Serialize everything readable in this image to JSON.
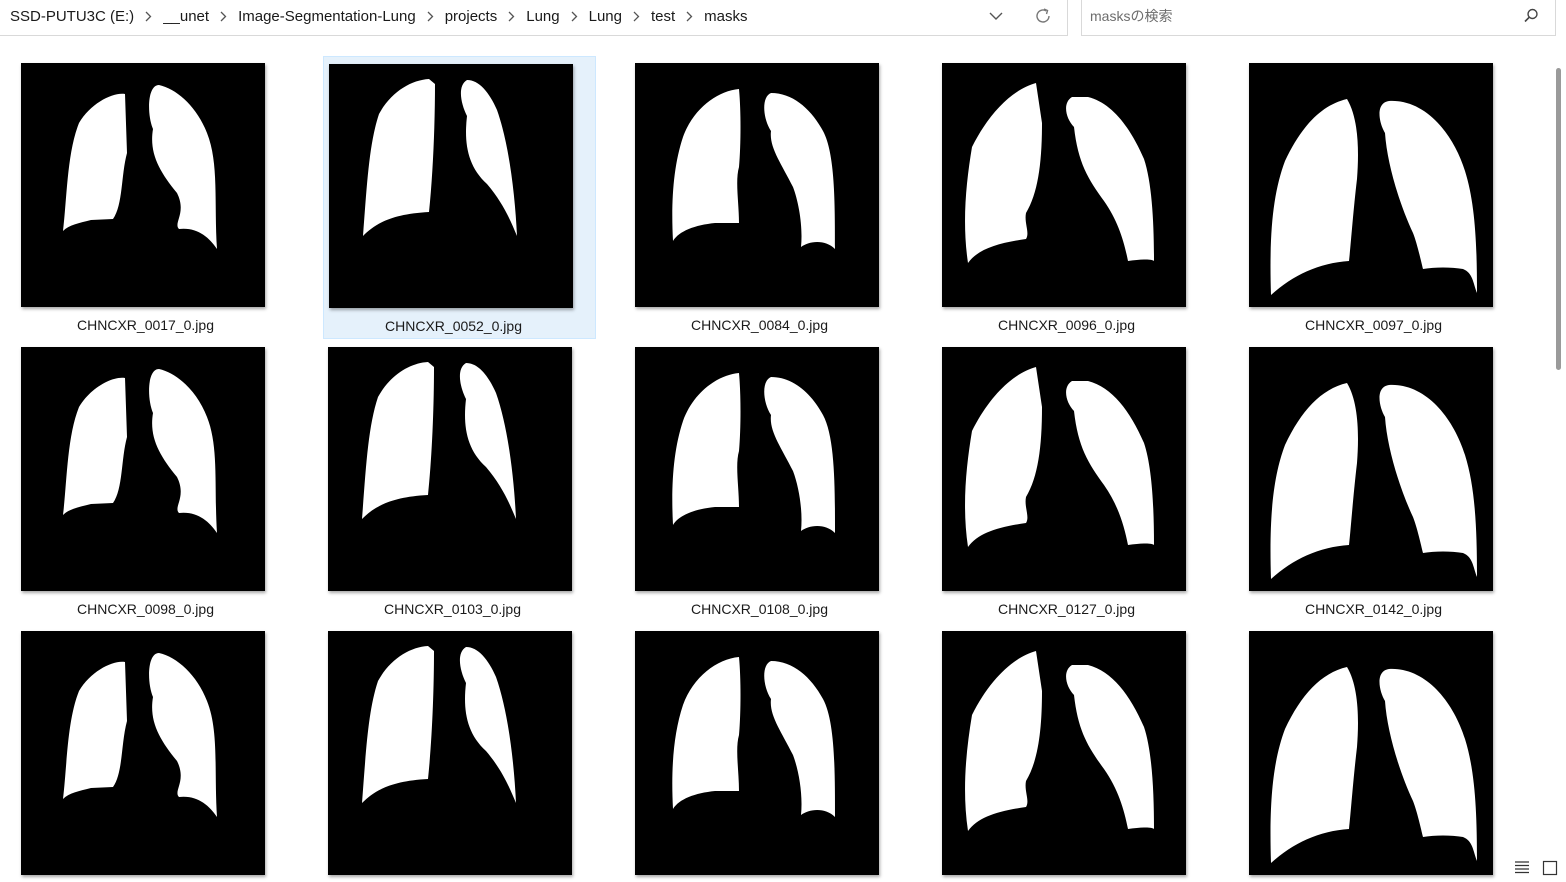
{
  "breadcrumb": {
    "items": [
      {
        "label": "SSD-PUTU3C (E:)"
      },
      {
        "label": "__unet"
      },
      {
        "label": "Image-Segmentation-Lung"
      },
      {
        "label": "projects"
      },
      {
        "label": "Lung"
      },
      {
        "label": "Lung"
      },
      {
        "label": "test"
      },
      {
        "label": "masks"
      }
    ],
    "separator_icon": "chevron-right-icon",
    "history_icon": "chevron-down-icon",
    "refresh_icon": "refresh-icon"
  },
  "search": {
    "placeholder": "masksの検索",
    "value": "",
    "icon": "search-icon"
  },
  "files": [
    {
      "name": "CHNCXR_0017_0.jpg",
      "selected": false
    },
    {
      "name": "CHNCXR_0052_0.jpg",
      "selected": true
    },
    {
      "name": "CHNCXR_0084_0.jpg",
      "selected": false
    },
    {
      "name": "CHNCXR_0096_0.jpg",
      "selected": false
    },
    {
      "name": "CHNCXR_0097_0.jpg",
      "selected": false
    },
    {
      "name": "CHNCXR_0098_0.jpg",
      "selected": false
    },
    {
      "name": "CHNCXR_0103_0.jpg",
      "selected": false
    },
    {
      "name": "CHNCXR_0108_0.jpg",
      "selected": false
    },
    {
      "name": "CHNCXR_0127_0.jpg",
      "selected": false
    },
    {
      "name": "CHNCXR_0142_0.jpg",
      "selected": false
    },
    {
      "name": "",
      "selected": false
    },
    {
      "name": "",
      "selected": false
    },
    {
      "name": "",
      "selected": false
    },
    {
      "name": "",
      "selected": false
    },
    {
      "name": "",
      "selected": false
    }
  ],
  "status": {
    "view_icons": [
      "list-view-icon",
      "tile-view-icon"
    ]
  },
  "colors": {
    "selection_bg": "#e5f1fb",
    "selection_border": "#cde8ff",
    "thumb_bg": "#000000",
    "mask_fill": "#ffffff"
  }
}
